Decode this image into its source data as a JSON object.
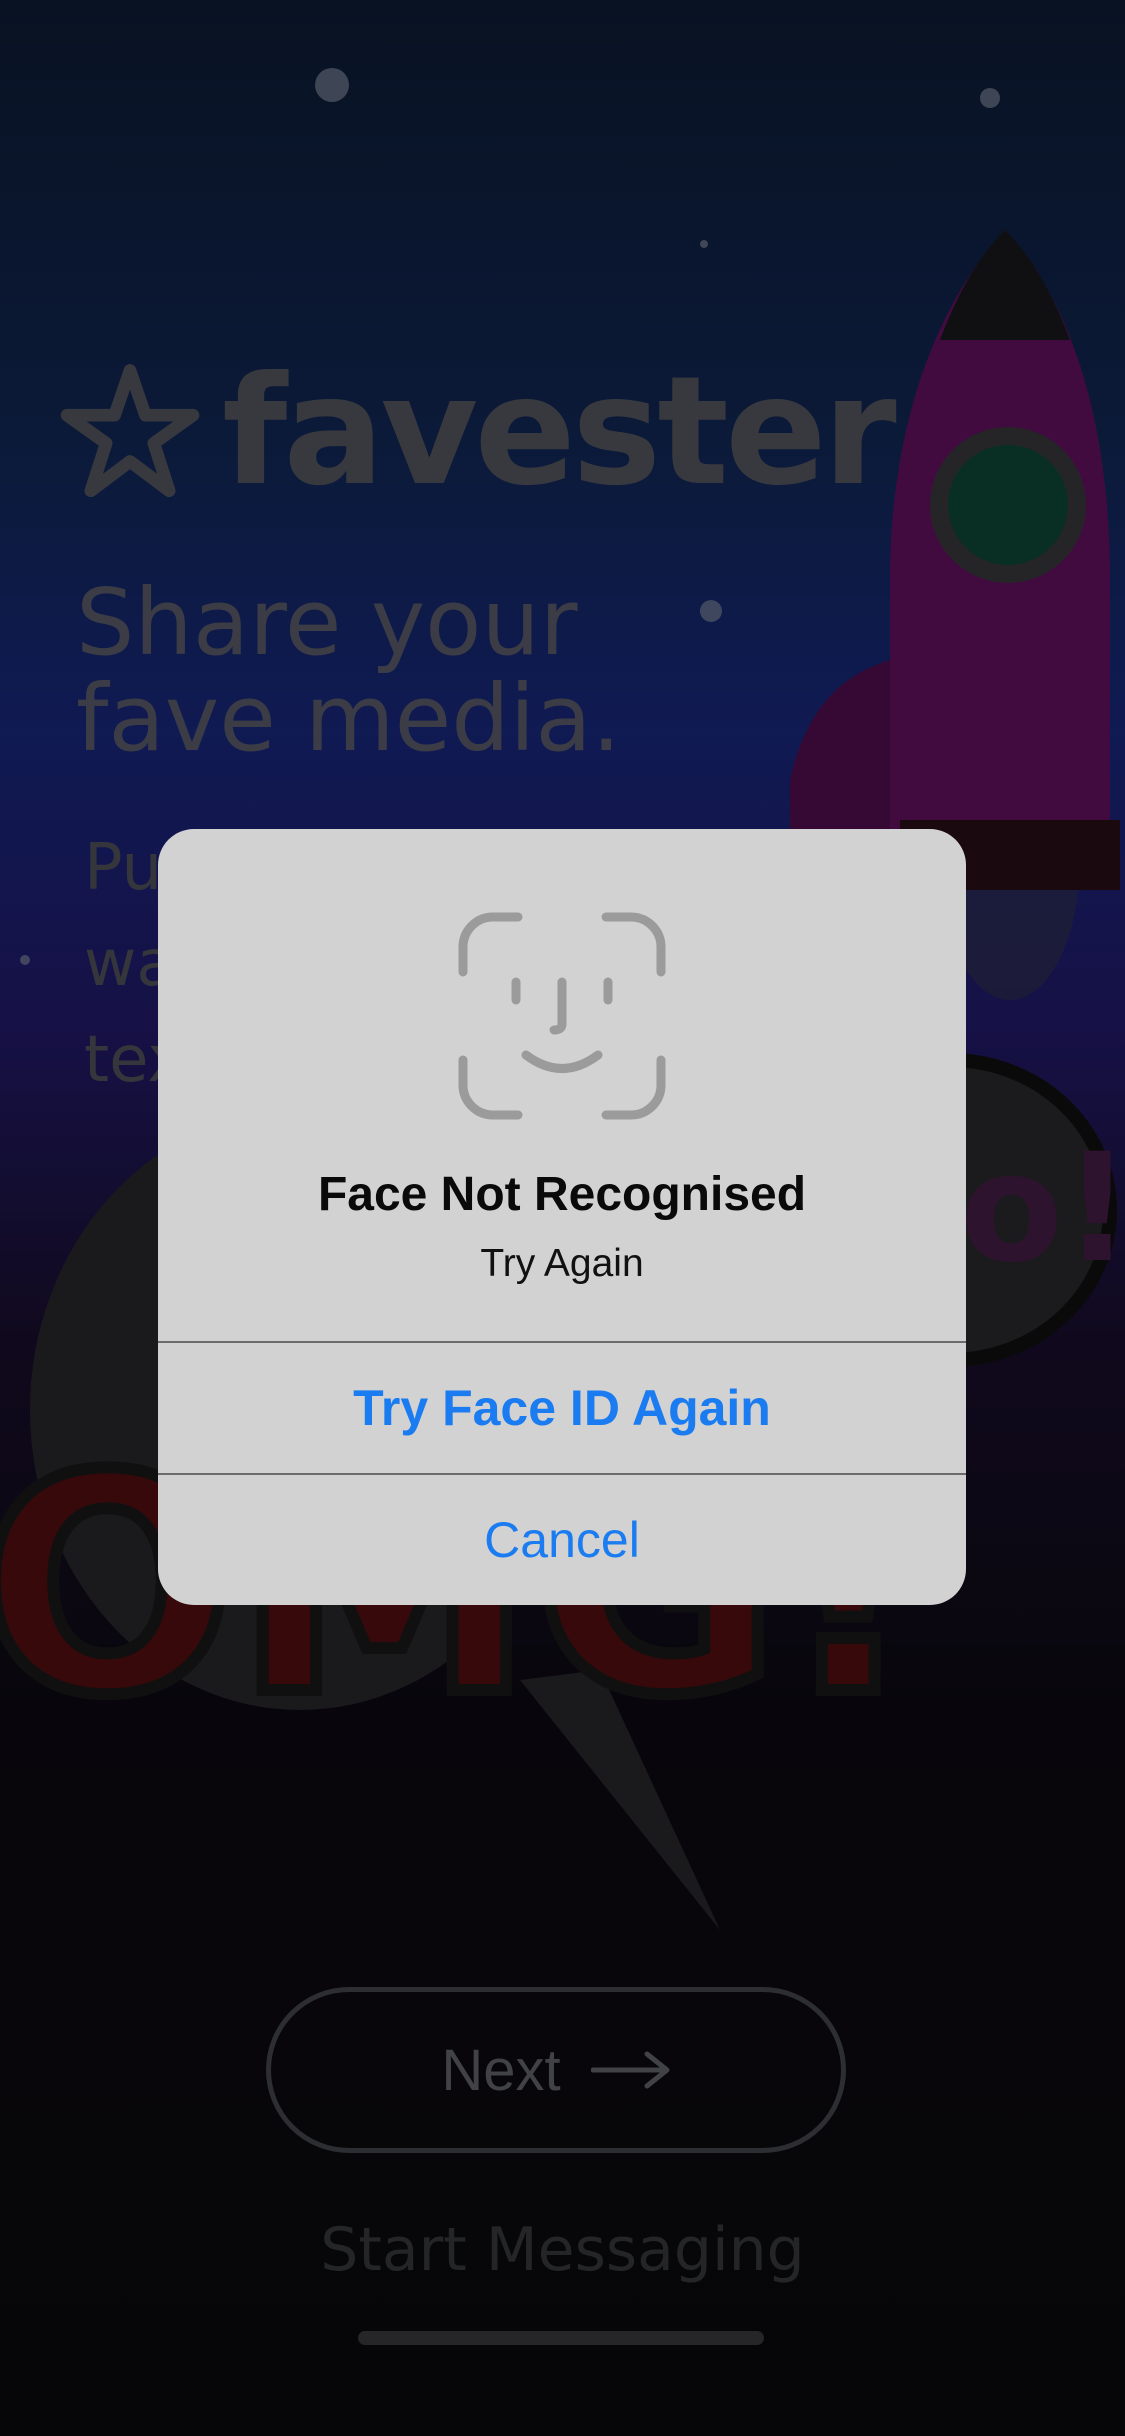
{
  "background": {
    "logo_text": "favester",
    "headline_line1": "Share your",
    "headline_line2": "fave media.",
    "subtext_fragments": [
      "Pu",
      "wa",
      "tex"
    ],
    "next_label": "Next",
    "start_messaging": "Start Messaging"
  },
  "alert": {
    "icon": "face-id-icon",
    "title": "Face Not Recognised",
    "message": "Try Again",
    "primary_button": "Try Face ID Again",
    "cancel_button": "Cancel"
  },
  "colors": {
    "accent": "#1a7cf0",
    "alert_bg": "#d2d2d2"
  }
}
